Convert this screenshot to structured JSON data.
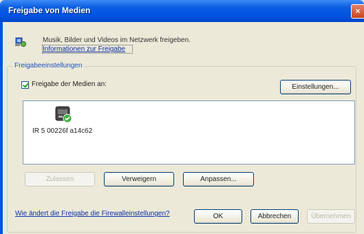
{
  "window": {
    "title": "Freigabe von Medien",
    "close_glyph": "×"
  },
  "header": {
    "description": "Musik, Bilder und Videos im Netzwerk freigeben.",
    "info_link": "Informationen zur Freigabe"
  },
  "sharing": {
    "group_label": "Freigabeeinstellungen",
    "share_checkbox_label": "Freigabe der Medien an:",
    "share_checked": true,
    "settings_button": "Einstellungen...",
    "devices": [
      {
        "label": "IR 5 00226f a14c62",
        "icon": "media-device-icon"
      }
    ],
    "allow_button": "Zulassen",
    "deny_button": "Verweigern",
    "customize_button": "Anpassen..."
  },
  "footer": {
    "firewall_link": "Wie ändert die Freigabe die Firewalleinstellungen?",
    "ok_button": "OK",
    "cancel_button": "Abbrechen",
    "apply_button": "Übernehmen"
  },
  "colors": {
    "titlebar": "#0054e3",
    "dialog_bg": "#ece9d8",
    "link": "#0a2fa8",
    "group_label": "#1a4fc2"
  }
}
